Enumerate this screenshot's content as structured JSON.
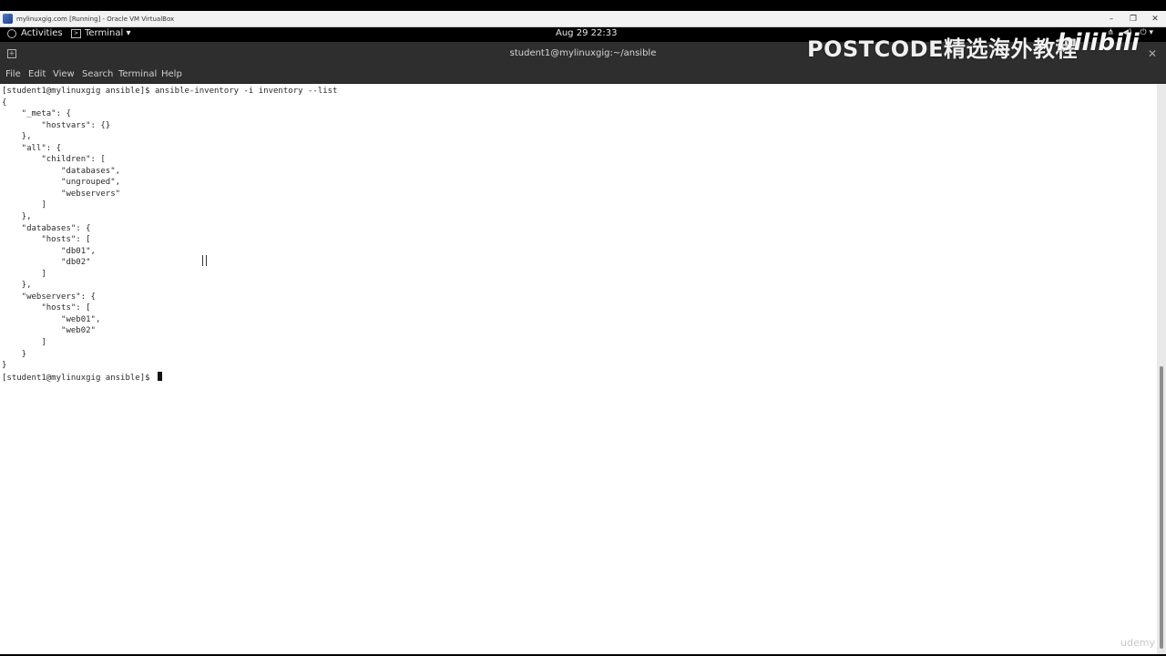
{
  "vbox": {
    "title": "mylinuxgig.com [Running] - Oracle VM VirtualBox",
    "minimize": "–",
    "restore": "❐",
    "close": "✕"
  },
  "gnome": {
    "activities": "Activities",
    "app_menu": "Terminal ▾",
    "clock": "Aug 29  22:33",
    "sys_icons": [
      "⋔",
      "◀)",
      "⏻ ▾"
    ]
  },
  "terminal": {
    "window_title": "student1@mylinuxgig:~/ansible",
    "close": "✕",
    "menu": [
      "File",
      "Edit",
      "View",
      "Search",
      "Terminal",
      "Help"
    ],
    "content": "[student1@mylinuxgig ansible]$ ansible-inventory -i inventory --list\n{\n    \"_meta\": {\n        \"hostvars\": {}\n    },\n    \"all\": {\n        \"children\": [\n            \"databases\",\n            \"ungrouped\",\n            \"webservers\"\n        ]\n    },\n    \"databases\": {\n        \"hosts\": [\n            \"db01\",\n            \"db02\"\n        ]\n    },\n    \"webservers\": {\n        \"hosts\": [\n            \"web01\",\n            \"web02\"\n        ]\n    }\n}\n[student1@mylinuxgig ansible]$ "
  },
  "watermarks": {
    "postcode": "POSTCODE精选海外教程",
    "bilibili": "bilibili",
    "udemy": "udemy"
  },
  "colors": {
    "terminal_bg": "#ffffff",
    "terminal_fg": "#2a2a2a",
    "headerbar": "#2e2e2e",
    "topbar": "#000000"
  }
}
